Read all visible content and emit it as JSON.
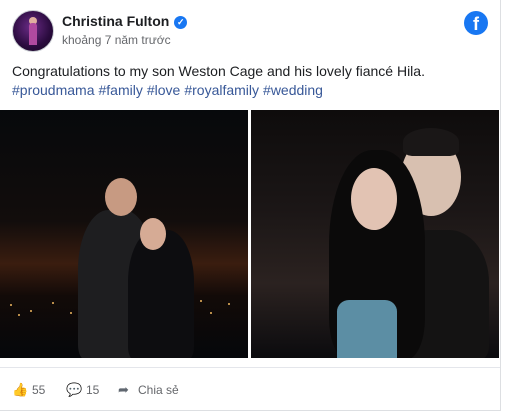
{
  "post": {
    "author": "Christina Fulton",
    "timestamp": "khoảng 7 năm trước",
    "text": "Congratulations to my son Weston Cage and his lovely fiancé Hila.",
    "hashtags": [
      "#proudmama",
      "#family",
      "#love",
      "#royalfamily",
      "#wedding"
    ]
  },
  "actions": {
    "likes": "55",
    "comments": "15",
    "share_label": "Chia sẻ"
  },
  "icons": {
    "verified": "verified-badge-icon",
    "platform": "facebook-logo-icon",
    "like": "thumbs-up-icon",
    "comment": "comment-icon",
    "share": "share-arrow-icon"
  },
  "colors": {
    "brand": "#1877f2",
    "hashtag": "#385898",
    "muted": "#65676b"
  }
}
